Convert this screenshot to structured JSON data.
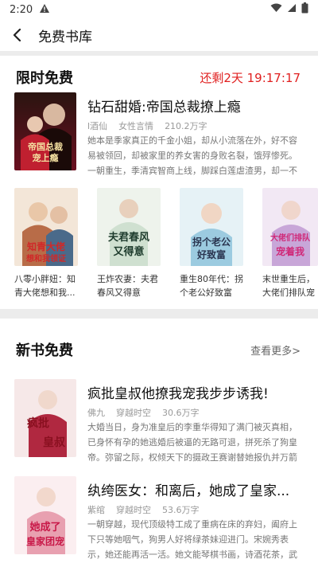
{
  "status": {
    "time": "2:20"
  },
  "appbar": {
    "title": "免费书库"
  },
  "limited": {
    "title": "限时免费",
    "countdown": "还剩2天 19:17:17",
    "featured": {
      "title": "钻石甜婚:帝国总裁撩上瘾",
      "author": "l酒仙",
      "genre": "女性言情",
      "words": "210.2万字",
      "desc": "她本是季家真正的千金小姐，却从小流落在外，好不容易被领回，却被家里的养女害的身败名裂，饿殍惨死。一朝重生，季清宾智商上线，脚踩白莲虐渣男，却一不小...",
      "cover_text": "帝国总裁宠上瘾"
    },
    "books": [
      {
        "title": "八零小胖妞：知青大佬想和我...",
        "cover_text": "知青大佬想和我领证"
      },
      {
        "title": "王炸农妻：夫君春风又得意",
        "cover_text": "夫君春风又得意"
      },
      {
        "title": "重生80年代：拐个老公好致富",
        "cover_text": "拐个老公好致富"
      },
      {
        "title": "末世重生后，大佬们排队宠着我",
        "cover_text": "大佬们排队宠着我"
      }
    ]
  },
  "newbooks": {
    "title": "新书免费",
    "more": "查看更多>",
    "items": [
      {
        "title": "疯批皇叔他撩我宠我步步诱我!",
        "author": "佛九",
        "genre": "穿越时空",
        "words": "30.6万字",
        "desc": "大婚当日，身为准皇后的李重华得知了满门被灭真相，已身怀有孕的她逃婚后被逼的无路可退，拼死杀了狗皇帝。弥留之际，权倾天下的摄政王赛谢替她报仇并万箭穿心之...",
        "cover_text": "疯批皇叔"
      },
      {
        "title": "纨绔医女：和离后，她成了皇家...",
        "author": "紫绾",
        "genre": "穿越时空",
        "words": "53.6万字",
        "desc": "一朝穿越，现代顶级特工成了重病在床的弃妇，阖府上下只等她咽气，狗男人好将绿茶妹迎进门。宋婉秀表示，她还能再活一活。她文能琴棋书画，诗酒花茶，武则刀枪...",
        "cover_text": "她成了皇家团宠"
      }
    ]
  }
}
